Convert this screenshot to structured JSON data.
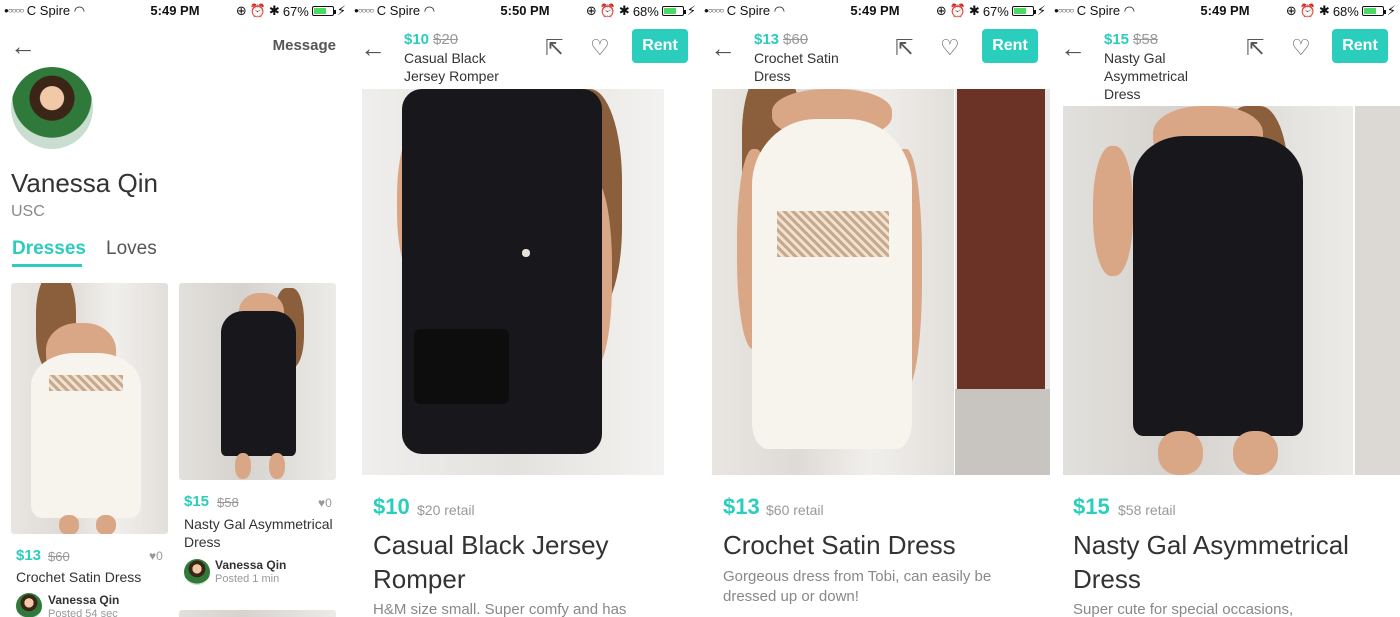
{
  "status_bars": [
    {
      "carrier": "C Spire",
      "time": "5:49 PM",
      "battery": "67%",
      "battery_level": 0.67
    },
    {
      "carrier": "C Spire",
      "time": "5:50 PM",
      "battery": "68%",
      "battery_level": 0.68
    },
    {
      "carrier": "C Spire",
      "time": "5:49 PM",
      "battery": "67%",
      "battery_level": 0.67
    },
    {
      "carrier": "C Spire",
      "time": "5:49 PM",
      "battery": "68%",
      "battery_level": 0.68
    }
  ],
  "icons": {
    "back": "←",
    "share": "⇱",
    "heart": "♡",
    "signal_dots": "●○○○○",
    "wifi": "◠",
    "alarm": "⏰",
    "lock": "⊕",
    "bluetooth": "✱",
    "charge": "⚡",
    "small_heart": "♥"
  },
  "colors": {
    "accent": "#2bcdbd"
  },
  "profile": {
    "message_label": "Message",
    "name": "Vanessa Qin",
    "school": "USC",
    "tabs": [
      "Dresses",
      "Loves"
    ],
    "cards": [
      {
        "price": "$13",
        "retail": "$60",
        "loves": "0",
        "title": "Crochet Satin Dress",
        "poster": "Vanessa Qin",
        "posted": "Posted 54 sec"
      },
      {
        "price": "$15",
        "retail": "$58",
        "loves": "0",
        "title": "Nasty Gal Asymmetrical Dress",
        "poster": "Vanessa Qin",
        "posted": "Posted 1 min"
      }
    ]
  },
  "products": [
    {
      "price": "$10",
      "retail": "$20",
      "retail_full": "$20 retail",
      "title_short": "Casual Black Jersey Romper",
      "title": "Casual Black Jersey Romper",
      "description": "H&M size small. Super comfy and has",
      "rent_label": "Rent"
    },
    {
      "price": "$13",
      "retail": "$60",
      "retail_full": "$60 retail",
      "title_short": "Crochet Satin Dress",
      "title": "Crochet Satin Dress",
      "description": "Gorgeous dress from Tobi, can easily be dressed up or down!",
      "rent_label": "Rent"
    },
    {
      "price": "$15",
      "retail": "$58",
      "retail_full": "$58 retail",
      "title_short": "Nasty Gal Asymmetrical Dress",
      "title": "Nasty Gal Asymmetrical Dress",
      "description": "Super cute for special occasions,",
      "rent_label": "Rent"
    }
  ]
}
